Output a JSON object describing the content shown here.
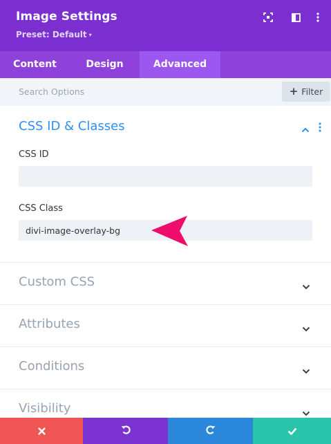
{
  "header": {
    "title": "Image Settings",
    "preset": "Preset: Default",
    "preset_caret": "▾",
    "icons": [
      "expand-icon",
      "split-view-icon",
      "more-vertical-icon"
    ]
  },
  "tabs": [
    {
      "label": "Content",
      "active": false
    },
    {
      "label": "Design",
      "active": false
    },
    {
      "label": "Advanced",
      "active": true
    }
  ],
  "search": {
    "placeholder": "Search Options",
    "filter_label": "Filter",
    "filter_icon": "+"
  },
  "css_section": {
    "title": "CSS ID & Classes",
    "css_id_label": "CSS ID",
    "css_id_value": "",
    "css_class_label": "CSS Class",
    "css_class_value": "divi-image-overlay-bg"
  },
  "sections": [
    {
      "title": "Custom CSS"
    },
    {
      "title": "Attributes"
    },
    {
      "title": "Conditions"
    },
    {
      "title": "Visibility"
    }
  ],
  "footer": {
    "icons": [
      "close-icon",
      "undo-icon",
      "redo-icon",
      "check-icon"
    ]
  },
  "colors": {
    "header": "#7b2fd0",
    "tabs": "#8e42db",
    "active_tab": "#9b57f0",
    "accent_blue": "#2d8ff5",
    "annotation_arrow": "#ee0d6c",
    "close": "#ef5555",
    "undo": "#7b33d1",
    "redo": "#2b87da",
    "save": "#29c4a9"
  }
}
